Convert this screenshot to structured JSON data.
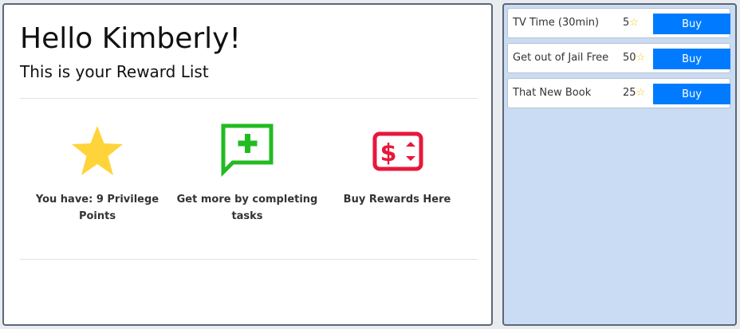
{
  "header": {
    "greeting": "Hello Kimberly!",
    "subtitle": "This is your Reward List"
  },
  "features": [
    {
      "icon": "star-icon",
      "label": "You have: 9 Privilege Points",
      "color": "#ffd43b"
    },
    {
      "icon": "add-comment-icon",
      "label": "Get more by completing tasks",
      "color": "#22bb22"
    },
    {
      "icon": "money-exchange-icon",
      "label": "Buy Rewards Here",
      "color": "#e8173b"
    }
  ],
  "rewards": [
    {
      "name": "TV Time (30min)",
      "cost": "5",
      "button": "Buy"
    },
    {
      "name": "Get out of Jail Free",
      "cost": "50",
      "button": "Buy"
    },
    {
      "name": "That New Book",
      "cost": "25",
      "button": "Buy"
    }
  ],
  "colors": {
    "accent": "#007bff",
    "panel_bg": "#cadcf3",
    "star": "#f5c518"
  }
}
